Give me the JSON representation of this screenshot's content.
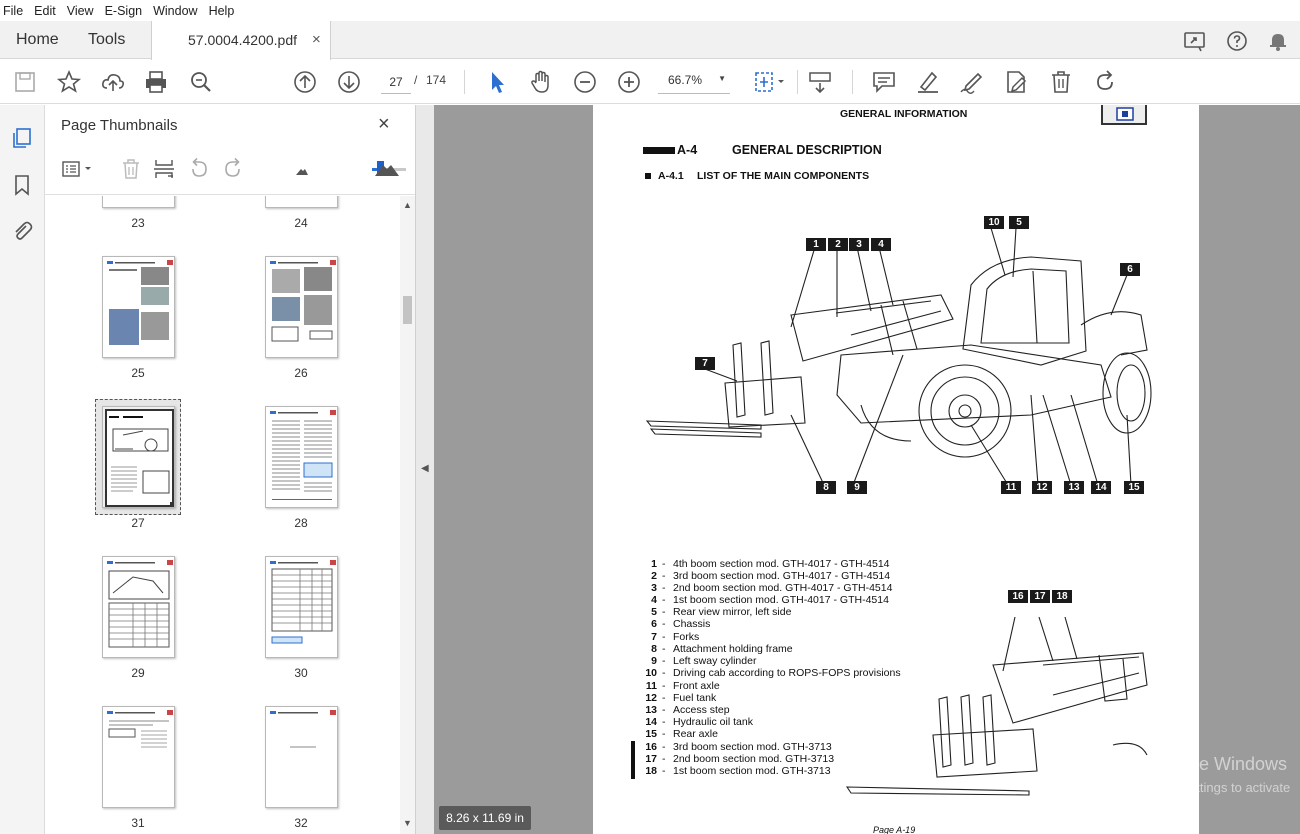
{
  "menu": [
    "File",
    "Edit",
    "View",
    "E-Sign",
    "Window",
    "Help"
  ],
  "tabs": {
    "home": "Home",
    "tools": "Tools",
    "document": "57.0004.4200.pdf",
    "close": "×"
  },
  "toolbar": {
    "current_page": "27",
    "separator": "/",
    "total_pages": "174",
    "zoom": "66.7%"
  },
  "panel": {
    "title": "Page Thumbnails",
    "close": "×",
    "slider_level": 0.25,
    "thumbnails": [
      {
        "label": "23"
      },
      {
        "label": "24"
      },
      {
        "label": "25"
      },
      {
        "label": "26"
      },
      {
        "label": "27",
        "selected": true
      },
      {
        "label": "28"
      },
      {
        "label": "29"
      },
      {
        "label": "30"
      },
      {
        "label": "31"
      },
      {
        "label": "32"
      }
    ]
  },
  "page": {
    "header": "GENERAL INFORMATION",
    "section_num": "A-4",
    "section_title": "GENERAL DESCRIPTION",
    "subsection_num": "A-4.1",
    "subsection_title": "LIST OF THE MAIN COMPONENTS",
    "callouts": [
      "1",
      "2",
      "3",
      "4",
      "10",
      "5",
      "6",
      "7",
      "8",
      "9",
      "11",
      "12",
      "13",
      "14",
      "15",
      "16",
      "17",
      "18"
    ],
    "legend": [
      {
        "n": "1",
        "text": "4th boom section mod. GTH-4017 - GTH-4514"
      },
      {
        "n": "2",
        "text": "3rd boom section mod. GTH-4017 - GTH-4514"
      },
      {
        "n": "3",
        "text": "2nd boom section mod. GTH-4017 - GTH-4514"
      },
      {
        "n": "4",
        "text": "1st boom section mod. GTH-4017 - GTH-4514"
      },
      {
        "n": "5",
        "text": "Rear view mirror, left side"
      },
      {
        "n": "6",
        "text": "Chassis"
      },
      {
        "n": "7",
        "text": "Forks"
      },
      {
        "n": "8",
        "text": "Attachment holding frame"
      },
      {
        "n": "9",
        "text": "Left sway cylinder"
      },
      {
        "n": "10",
        "text": "Driving cab according to ROPS-FOPS provisions"
      },
      {
        "n": "11",
        "text": "Front axle"
      },
      {
        "n": "12",
        "text": "Fuel tank"
      },
      {
        "n": "13",
        "text": "Access step"
      },
      {
        "n": "14",
        "text": "Hydraulic oil tank"
      },
      {
        "n": "15",
        "text": "Rear axle"
      },
      {
        "n": "16",
        "text": "3rd boom section mod. GTH-3713"
      },
      {
        "n": "17",
        "text": "2nd boom section mod. GTH-3713"
      },
      {
        "n": "18",
        "text": "1st boom section mod. GTH-3713"
      }
    ],
    "dash": "-",
    "footer": "Page A-19"
  },
  "status": {
    "page_size": "8.26 x 11.69 in"
  },
  "watermark": {
    "line1": "Activate Windows",
    "line2": "Go to Settings to activate"
  },
  "colors": {
    "accent": "#2c6fd1",
    "doc_bg": "#9b9b9b"
  }
}
